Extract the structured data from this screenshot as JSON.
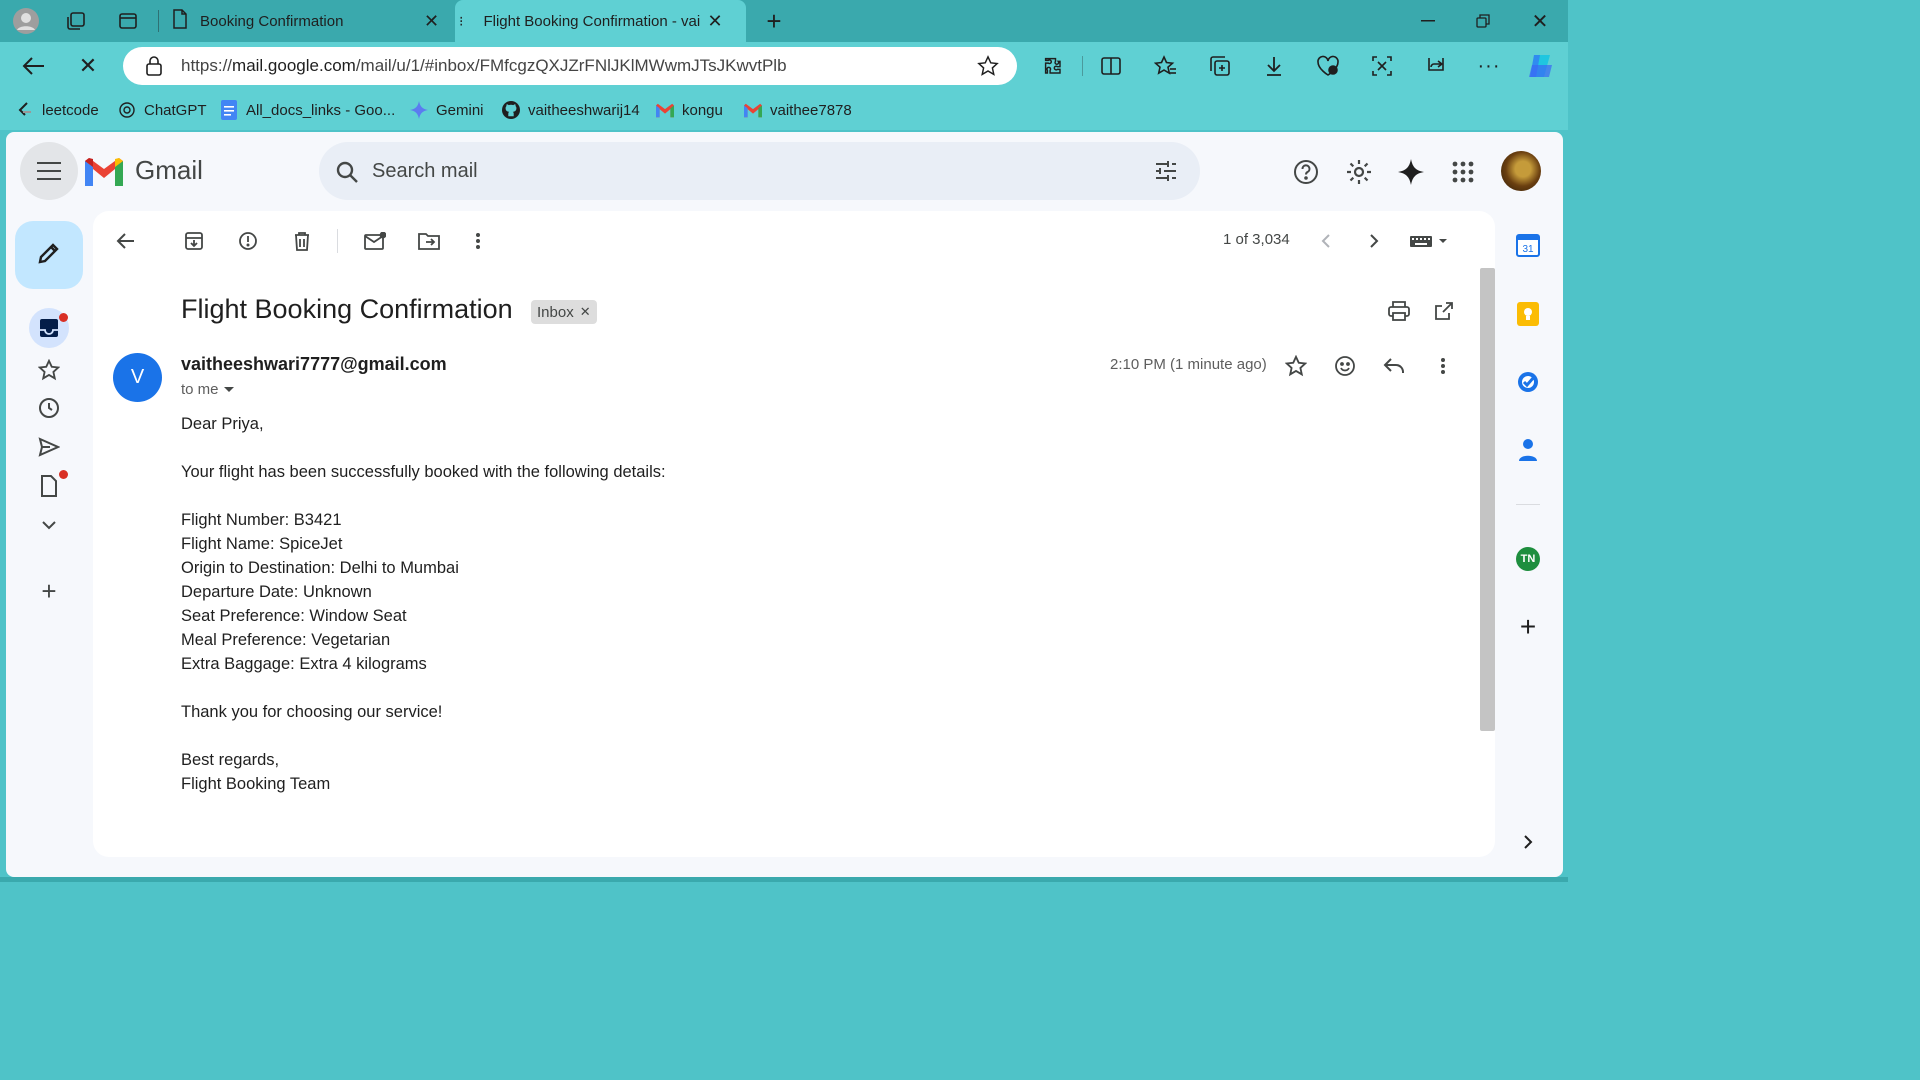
{
  "browser": {
    "tabs": [
      {
        "title": "Booking Confirmation",
        "active": false
      },
      {
        "title": "Flight Booking Confirmation - vai",
        "active": true
      }
    ],
    "address": {
      "prefix": "https://",
      "host": "mail.google.com",
      "path": "/mail/u/1/#inbox/FMfcgzQXJZrFNlJKlMWwmJTsJKwvtPlb"
    },
    "bookmarks": [
      {
        "label": "leetcode",
        "icon": "leetcode-icon"
      },
      {
        "label": "ChatGPT",
        "icon": "chatgpt-icon"
      },
      {
        "label": "All_docs_links - Goo...",
        "icon": "docs-icon"
      },
      {
        "label": "Gemini",
        "icon": "gemini-icon"
      },
      {
        "label": "vaitheeshwarij14",
        "icon": "github-icon"
      },
      {
        "label": "kongu",
        "icon": "gmail-icon"
      },
      {
        "label": "vaithee7878",
        "icon": "gmail-icon"
      }
    ]
  },
  "gmail": {
    "app_name": "Gmail",
    "search_placeholder": "Search mail",
    "pagination": "1 of 3,034",
    "email": {
      "subject": "Flight Booking Confirmation",
      "label": "Inbox",
      "sender_initial": "V",
      "sender": "vaitheeshwari7777@gmail.com",
      "recipient": "to me",
      "time": "2:10 PM (1 minute ago)",
      "body": [
        "Dear Priya,",
        "",
        "Your flight has been successfully booked with the following details:",
        "",
        "Flight Number: B3421",
        "Flight Name: SpiceJet",
        "Origin to Destination: Delhi to Mumbai",
        "Departure Date: Unknown",
        "Seat Preference: Window Seat",
        "Meal Preference: Vegetarian",
        "Extra Baggage: Extra 4 kilograms",
        "",
        "Thank you for choosing our service!",
        "",
        "Best regards,",
        "Flight Booking Team"
      ]
    },
    "side_panel": {
      "calendar_day": "31",
      "contact_badge": "TN"
    }
  },
  "colors": {
    "chrome": "#3aa9ad",
    "toolbar": "#5fd0d3",
    "compose": "#c2e7ff",
    "avatar": "#1a73e8"
  }
}
